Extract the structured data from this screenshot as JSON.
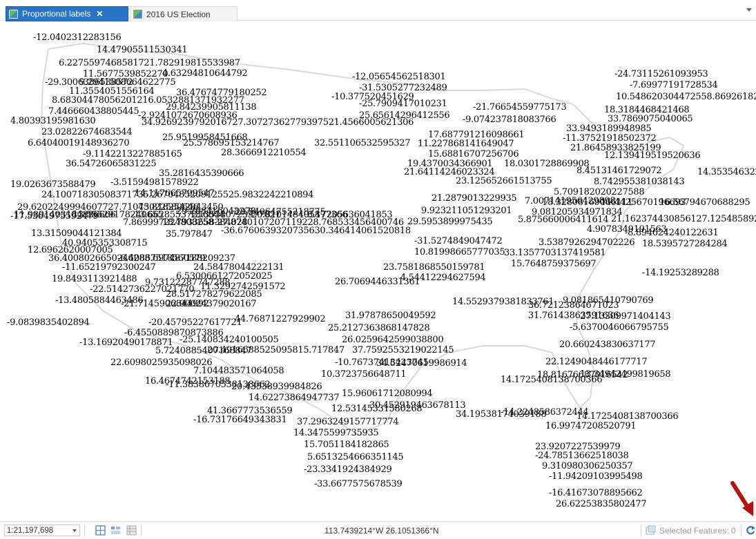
{
  "tabs": [
    {
      "label": "Proportional labels",
      "active": true,
      "close": "✕",
      "icon": "map-icon"
    },
    {
      "label": "2016 US Election",
      "active": false,
      "icon": "map-icon"
    }
  ],
  "map": {
    "labels": [
      "-12.0402312283156",
      "14.47905511530341",
      "6.2275597468581721.782919815533987",
      "11.5677539852270",
      "4.63294810644792",
      "-29.3006386538572",
      "9.2941508664622775",
      "11.3554051556164",
      "36.47674779180252",
      "8.68304478056201216.0532881371932277",
      "29.84239905811138",
      "7.446660438805445",
      "-2.9241072670608936",
      "4.80393195981630",
      "34.9269239792016727.30727362779397521.4566005621306",
      "23.02822674683544",
      "25.9519958451668",
      "6.64040019148936270",
      "25.578695153214767",
      "32.551106532595327",
      "-9.1142213227885165",
      "28.3666912210554",
      "36.54726065831225",
      "35.2816435390666",
      "19.0263673588479",
      "-3.51594981578922",
      "24.10071830508371735.2670485209125525.9832242210894",
      "14.117665799547",
      "29.6202249994607727.71075022580646",
      "43.8182542843450",
      "29.268416043278",
      "29.54064755218775",
      "-17.5364975592479",
      "7.869997224808258",
      "18.7933658384028",
      "-27.8740107207119228.768533456400746",
      "13.31509044121384",
      "35.797847",
      "-36.6760639320735630.346414061520818",
      "40.9405353308715",
      "12.6962620007005",
      "36.4008026650246283.697487188209237",
      "-6.40867518560579",
      "-11.65219792300247",
      "24.58478044222131",
      "6.5300661272052025",
      "19.8493113921488",
      "9.73122287747288",
      "11.3292742591572",
      "-22.5142736227021770",
      "28.517278279622085",
      "-13.4805884463486",
      "-21.7145906844992",
      "22.90024379020167",
      "-9.0839835402894",
      "-20.45795227617721",
      "44.76871227929902",
      "-6.4550889870873886",
      "-25.140834240100505",
      "-13.16920490178871",
      "20.4916688525095815.717847",
      "5.7240885407168847",
      "22.6098025935098026",
      "7.104483571064058",
      "16.4674742153188",
      "-11.3838670538138662",
      "20.43538939984826",
      "14.62273864947737",
      "41.3667773536559",
      "-16.73176649343831",
      "14.3475599735935",
      "15.7051184182865",
      "5.6513254666351145",
      "-23.3341924384929",
      "-33.6677575678539",
      "-12.05654562518301",
      "-31.5305277232489",
      "-10.377520451629",
      "-25.7909417010231",
      "-21.76654559775173",
      "25.65614296412556",
      "-9.074237818083766",
      "17.687791216098661",
      "11.227868141649047",
      "15.68816707256706",
      "19.4370034366901",
      "18.0301728869908",
      "21.64114246023324",
      "23.125652661513755",
      "21.2879013229935",
      "9.923211051293201",
      "29.5953899975435",
      "5.875660006411614",
      "4.9078349191563",
      "-31.5274849047472",
      "10.81998665777035",
      "3.5387926294702226",
      "33.1357703137419581",
      "15.7648759375697",
      "23.7581868550159781",
      "4.54412294627594",
      "26.7069446331361",
      "14.5529379381833761",
      "36.72123864671023",
      "31.97878650049592",
      "31.76143863591636",
      "25.2127363868147828",
      "26.0259642599038800",
      "37.7592553219022145",
      "-10.76737418423745",
      "34.52470619986914",
      "14.1725408138700366",
      "10.3723756648711",
      "15.96061712080994",
      "30.452919463678113",
      "12.53145331580268",
      "34.19538174039188",
      "37.2963249157717774",
      "-24.73115261093953",
      "-7.69977191728534",
      "10.548620304472558.869261821944178",
      "18.3184468421468",
      "33.7869075040065",
      "33.9493189948985",
      "-11.37521918502372",
      "21.86458933825199",
      "12.139419519520636",
      "8.45131461729072",
      "14.35354632224276",
      "8.742955381038143",
      "5.709182020227588",
      "7.007141956429898",
      "9.081205934971834",
      "21.162374430856127.1254858927683",
      "-8.894624240122631",
      "18.5395727284284",
      "-14.19253289288",
      "9.081865410790769",
      "27.13309971404143",
      "-5.6370046066795755",
      "20.660243830637177",
      "22.1249048446177717",
      "18.81676687016542",
      "13.34942499819658",
      "-14.2248586372444",
      "14.1725408138700366",
      "16.99747208520791",
      "23.9207227539979",
      "-24.78513662518038",
      "9.310980306250357",
      "-11.94209103995498",
      "-16.41673078895662",
      "26.62253835802477",
      "18.32808169066111",
      "11.4425670196693",
      "16.56794670688295",
      "11.9891403184886666",
      "13.55529178240655",
      "-13.66285537256844",
      "18.35380723577021",
      "-20.810148405877366",
      "8.17205636041853"
    ]
  },
  "status": {
    "scale": "1:21,197,698",
    "coordinates": "113.7439214°W 26.1051366°N",
    "selected_features": "Selected Features: 0",
    "arrow_color": "#b3120f"
  }
}
